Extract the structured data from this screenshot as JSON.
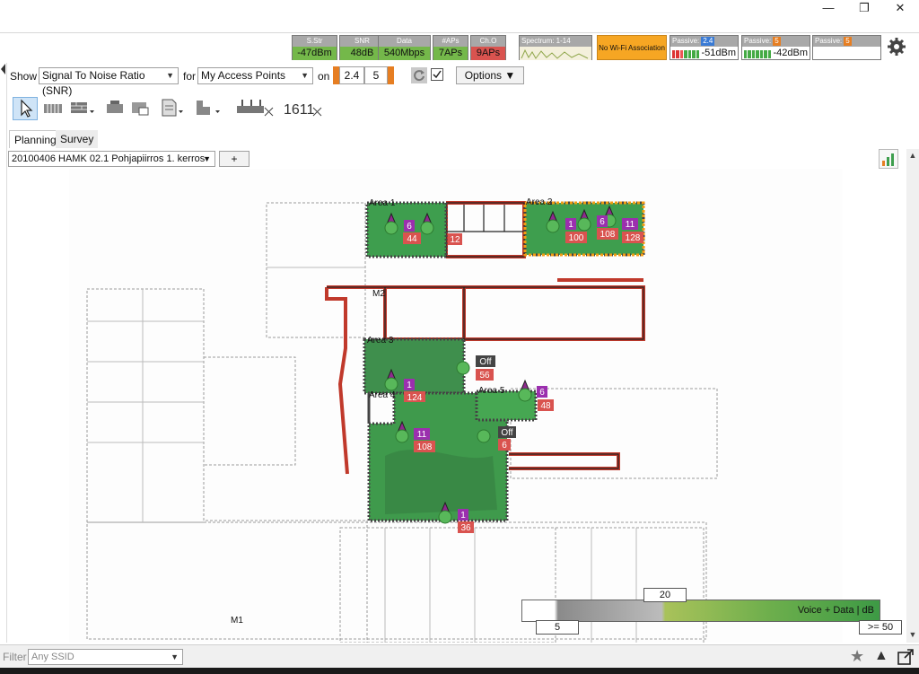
{
  "window": {
    "minimize": "—",
    "maximize": "❐",
    "close": "✕"
  },
  "stats": [
    {
      "label": "S.Str",
      "value": "-47dBm"
    },
    {
      "label": "SNR",
      "value": "48dB"
    },
    {
      "label": "Data",
      "value": "540Mbps"
    },
    {
      "label": "#APs",
      "value": "7APs"
    },
    {
      "label": "Ch.O",
      "value": "9APs"
    }
  ],
  "spectrum": {
    "label": "Spectrum: 1-14"
  },
  "no_wifi": "No Wi-Fi Association",
  "passive": [
    {
      "label": "Passive:",
      "chip": "2.4",
      "value": "-51dBm"
    },
    {
      "label": "Passive:",
      "chip": "5",
      "value": "-42dBm"
    },
    {
      "label": "Passive:",
      "chip": "5",
      "value": ""
    }
  ],
  "toolbar": {
    "show_label": "Show",
    "show_value": "Signal To Noise Ratio (SNR)",
    "for_label": "for",
    "for_value": "My Access Points",
    "on_label": "on",
    "band_24": "2.4",
    "band_5": "5",
    "options": "Options"
  },
  "tools": {
    "counter": "1611"
  },
  "tabs": {
    "planning": "Planning",
    "survey": "Survey"
  },
  "floor": {
    "name": "20100406 HAMK 02.1 Pohjapiirros 1. kerros",
    "add": "+"
  },
  "map": {
    "areas": [
      "Area 1",
      "Area 2",
      "Area 3",
      "Area 4",
      "Area 5"
    ],
    "ap_labels": [
      "6",
      "44",
      "12",
      "1",
      "100",
      "6",
      "108",
      "11",
      "128",
      "Off",
      "56",
      "1",
      "124",
      "6",
      "48",
      "11",
      "108",
      "Off",
      "6",
      "1",
      "36",
      "M2",
      "M1"
    ]
  },
  "legend": {
    "title": "Voice + Data | dB",
    "low": "5",
    "mid": "20",
    "high": ">= 50"
  },
  "bottom": {
    "filter_label": "Filter",
    "ssid_placeholder": "Any SSID"
  }
}
